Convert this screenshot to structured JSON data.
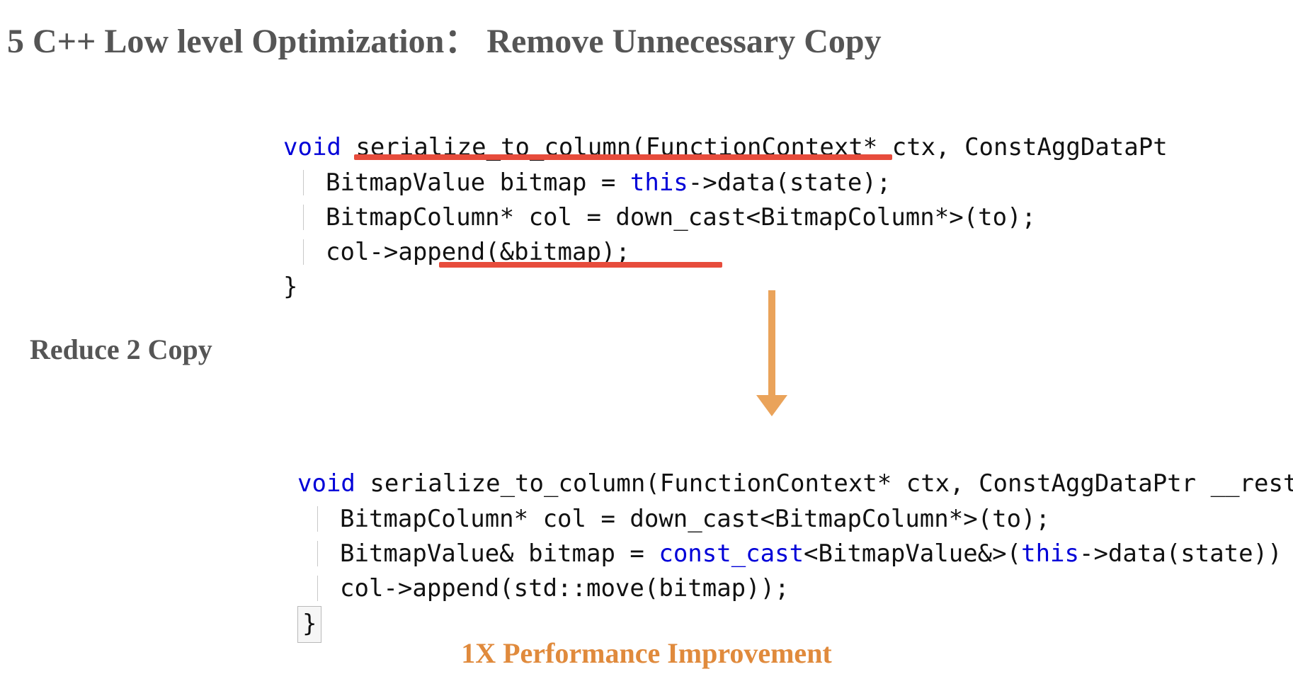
{
  "title": "5 C++ Low level Optimization：  Remove Unnecessary Copy",
  "subheading": "Reduce 2 Copy",
  "performance": "1X Performance Improvement",
  "code_top": {
    "l1_kw": "void",
    "l1_rest": " serialize_to_column(FunctionContext* ctx, ConstAggDataPt",
    "l2a": "BitmapValue bitmap = ",
    "l2_kw": "this",
    "l2b": "->data(state);",
    "l3": "BitmapColumn* col = down_cast<BitmapColumn*>(to);",
    "l4": "col->append(&bitmap);",
    "l5": "}"
  },
  "code_bottom": {
    "l1_kw": "void",
    "l1_rest": " serialize_to_column(FunctionContext* ctx, ConstAggDataPtr __rest",
    "l2": "BitmapColumn* col = down_cast<BitmapColumn*>(to);",
    "l3a": "BitmapValue& bitmap = ",
    "l3_kw1": "const_cast",
    "l3b": "<BitmapValue&>(",
    "l3_kw2": "this",
    "l3c": "->data(state))",
    "l4": "col->append(std::move(bitmap));",
    "l5": "}"
  }
}
